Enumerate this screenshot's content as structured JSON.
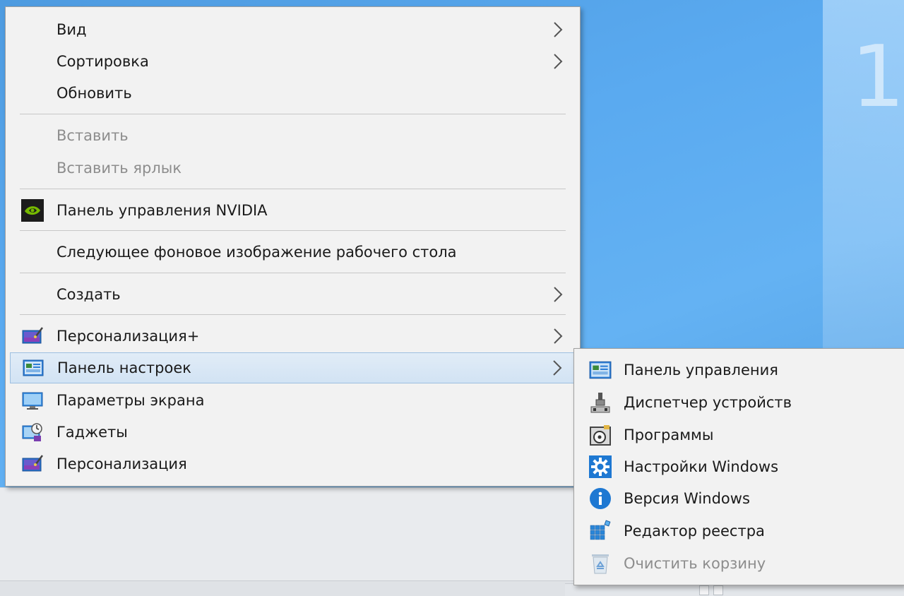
{
  "main_menu": {
    "items": [
      {
        "label": "Вид",
        "submenu": true,
        "disabled": false
      },
      {
        "label": "Сортировка",
        "submenu": true,
        "disabled": false
      },
      {
        "label": "Обновить",
        "submenu": false,
        "disabled": false
      },
      {
        "label": "Вставить",
        "submenu": false,
        "disabled": true
      },
      {
        "label": "Вставить ярлык",
        "submenu": false,
        "disabled": true
      },
      {
        "label": "Панель управления NVIDIA",
        "icon": "nvidia-icon",
        "submenu": false,
        "disabled": false
      },
      {
        "label": "Следующее фоновое изображение рабочего стола",
        "submenu": false,
        "disabled": false
      },
      {
        "label": "Создать",
        "submenu": true,
        "disabled": false
      },
      {
        "label": "Персонализация+",
        "icon": "personalization-icon",
        "submenu": true,
        "disabled": false
      },
      {
        "label": "Панель настроек",
        "icon": "control-panel-icon",
        "submenu": true,
        "disabled": false,
        "highlighted": true
      },
      {
        "label": "Параметры экрана",
        "icon": "display-icon",
        "submenu": false,
        "disabled": false
      },
      {
        "label": "Гаджеты",
        "icon": "gadgets-icon",
        "submenu": false,
        "disabled": false
      },
      {
        "label": "Персонализация",
        "icon": "personalization-icon",
        "submenu": false,
        "disabled": false
      }
    ]
  },
  "sub_menu": {
    "items": [
      {
        "label": "Панель управления",
        "icon": "control-panel-icon",
        "disabled": false
      },
      {
        "label": "Диспетчер устройств",
        "icon": "device-manager-icon",
        "disabled": false
      },
      {
        "label": "Программы",
        "icon": "programs-icon",
        "disabled": false
      },
      {
        "label": "Настройки Windows",
        "icon": "gear-icon",
        "disabled": false
      },
      {
        "label": "Версия Windows",
        "icon": "info-icon",
        "disabled": false
      },
      {
        "label": "Редактор реестра",
        "icon": "registry-icon",
        "disabled": false
      },
      {
        "label": "Очистить корзину",
        "icon": "recycle-bin-icon",
        "disabled": true
      }
    ]
  },
  "colors": {
    "desktop": "#5aaaf0",
    "menu_bg": "#f2f2f2",
    "highlight_bg": "#d9e7f5",
    "highlight_border": "#9dbfe0",
    "disabled_text": "#8d8d8d",
    "nvidia_green": "#76b900",
    "accent_blue": "#1e78d2"
  }
}
